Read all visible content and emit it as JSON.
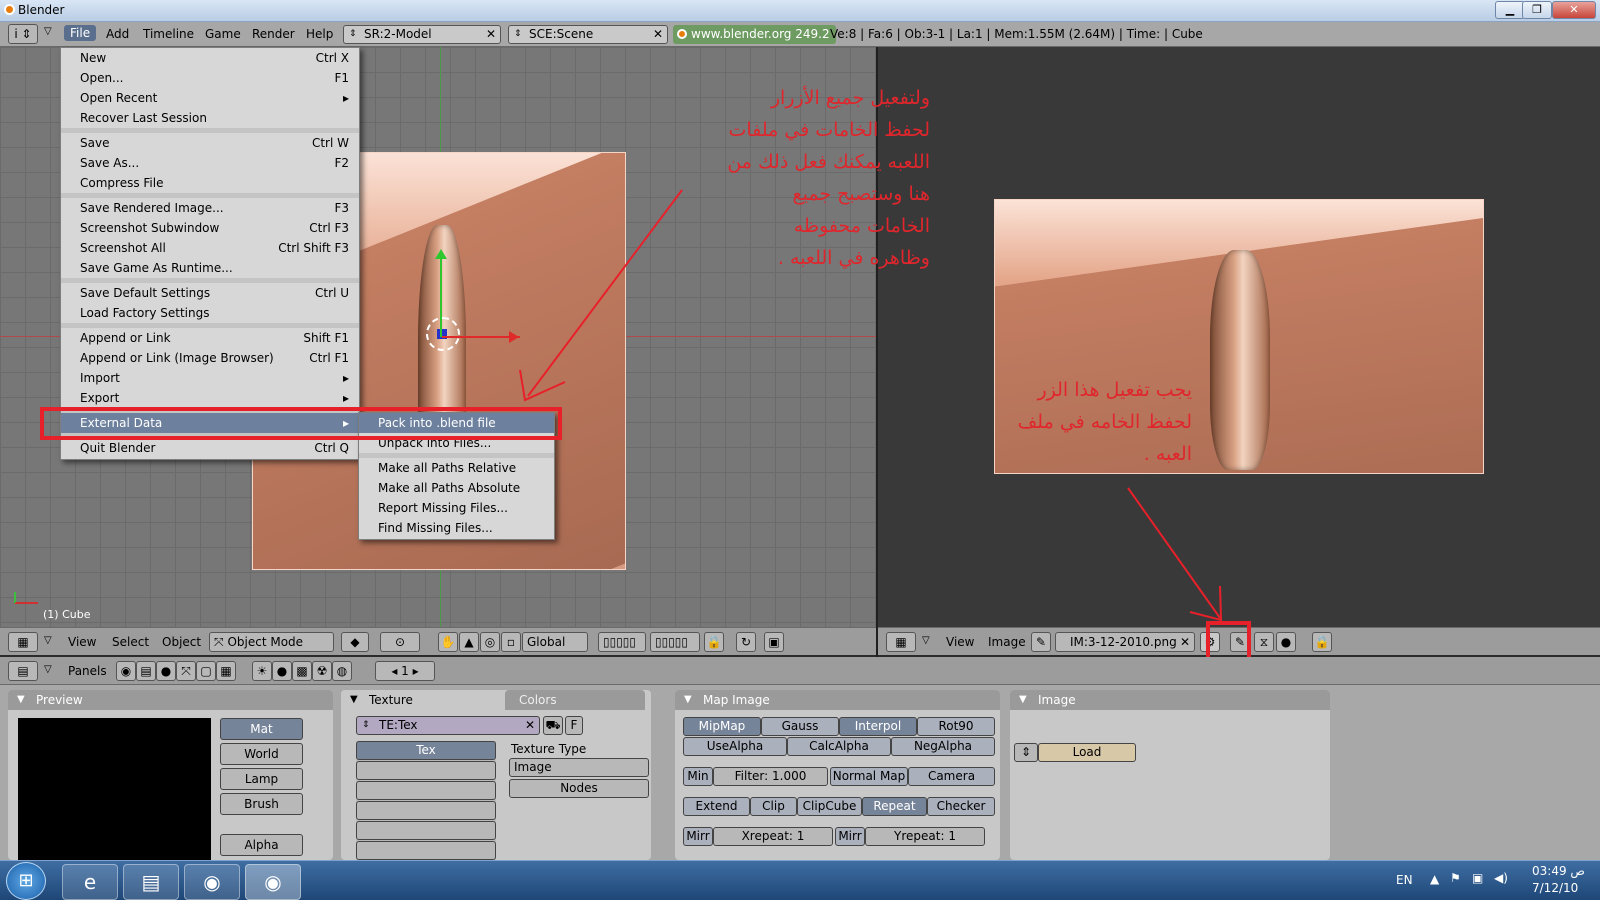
{
  "window": {
    "title": "Blender"
  },
  "info_header": {
    "menus": [
      "File",
      "Add",
      "Timeline",
      "Game",
      "Render",
      "Help"
    ],
    "screen_field": "SR:2-Model",
    "scene_field": "SCE:Scene",
    "blend_link": "www.blender.org 249.2",
    "stats": "Ve:8 | Fa:6 | Ob:3-1 | La:1  | Mem:1.55M (2.64M)  | Time: | Cube"
  },
  "file_menu": {
    "items": [
      {
        "label": "New",
        "shortcut": "Ctrl X"
      },
      {
        "label": "Open...",
        "shortcut": "F1"
      },
      {
        "label": "Open Recent",
        "shortcut": "▸"
      },
      {
        "label": "Recover Last Session",
        "shortcut": ""
      },
      {
        "label": "Save",
        "shortcut": "Ctrl W"
      },
      {
        "label": "Save As...",
        "shortcut": "F2"
      },
      {
        "label": "Compress File",
        "shortcut": ""
      },
      {
        "label": "Save Rendered Image...",
        "shortcut": "F3"
      },
      {
        "label": "Screenshot Subwindow",
        "shortcut": "Ctrl F3"
      },
      {
        "label": "Screenshot All",
        "shortcut": "Ctrl Shift F3"
      },
      {
        "label": "Save Game As Runtime...",
        "shortcut": ""
      },
      {
        "label": "Save Default Settings",
        "shortcut": "Ctrl U"
      },
      {
        "label": "Load Factory Settings",
        "shortcut": ""
      },
      {
        "label": "Append or Link",
        "shortcut": "Shift F1"
      },
      {
        "label": "Append or Link (Image Browser)",
        "shortcut": "Ctrl F1"
      },
      {
        "label": "Import",
        "shortcut": "▸"
      },
      {
        "label": "Export",
        "shortcut": "▸"
      },
      {
        "label": "External Data",
        "shortcut": "▸"
      },
      {
        "label": "Quit Blender",
        "shortcut": "Ctrl Q"
      }
    ]
  },
  "external_submenu": {
    "items": [
      "Pack into .blend file",
      "Unpack into Files...",
      "Make all Paths Relative",
      "Make all Paths Absolute",
      "Report Missing Files...",
      "Find Missing Files..."
    ]
  },
  "annotations": {
    "top_note": [
      "ولتفعيل جميع الأزرار",
      "لحفظ الخامات في ملفات",
      "اللعبه يمكنك فعل ذلك من",
      "هنا وستصبح جميع",
      "الخامات محفوظه",
      "وظاهره في اللعبه ."
    ],
    "right_note": [
      "يجب تفعيل هذا الزر",
      "لحفظ الخامه في ملف",
      "العبه ."
    ]
  },
  "view3d": {
    "object_label": "(1) Cube"
  },
  "view3d_header": {
    "menus": [
      "View",
      "Select",
      "Object"
    ],
    "mode": "Object Mode",
    "orientation": "Global"
  },
  "image_header": {
    "menus": [
      "View",
      "Image"
    ],
    "image_name": "IM:3-12-2010.png"
  },
  "buttons_header": {
    "panels_label": "Panels",
    "frame": "1"
  },
  "preview_panel": {
    "title": "Preview",
    "buttons": [
      "Mat",
      "World",
      "Lamp",
      "Brush",
      "Alpha"
    ]
  },
  "texture_panel": {
    "tabs": [
      "Texture",
      "Colors"
    ],
    "texture_name": "TE:Tex",
    "f_label": "F",
    "list_header": "Tex",
    "type_label": "Texture Type",
    "type_value": "Image",
    "nodes_label": "Nodes"
  },
  "map_image_panel": {
    "title": "Map Image",
    "row1": [
      "MipMap",
      "Gauss",
      "Interpol",
      "Rot90"
    ],
    "row2": [
      "UseAlpha",
      "CalcAlpha",
      "NegAlpha"
    ],
    "min_label": "Min",
    "filter": "Filter: 1.000",
    "normal_map": "Normal Map",
    "space": "Camera",
    "row4": [
      "Extend",
      "Clip",
      "ClipCube",
      "Repeat",
      "Checker"
    ],
    "mirr": "Mirr",
    "xrepeat": "Xrepeat: 1",
    "yrepeat": "Yrepeat: 1"
  },
  "image_panel": {
    "title": "Image",
    "load_label": "Load"
  },
  "taskbar": {
    "lang": "EN",
    "time": "03:49 ص",
    "date": "7/12/10"
  }
}
